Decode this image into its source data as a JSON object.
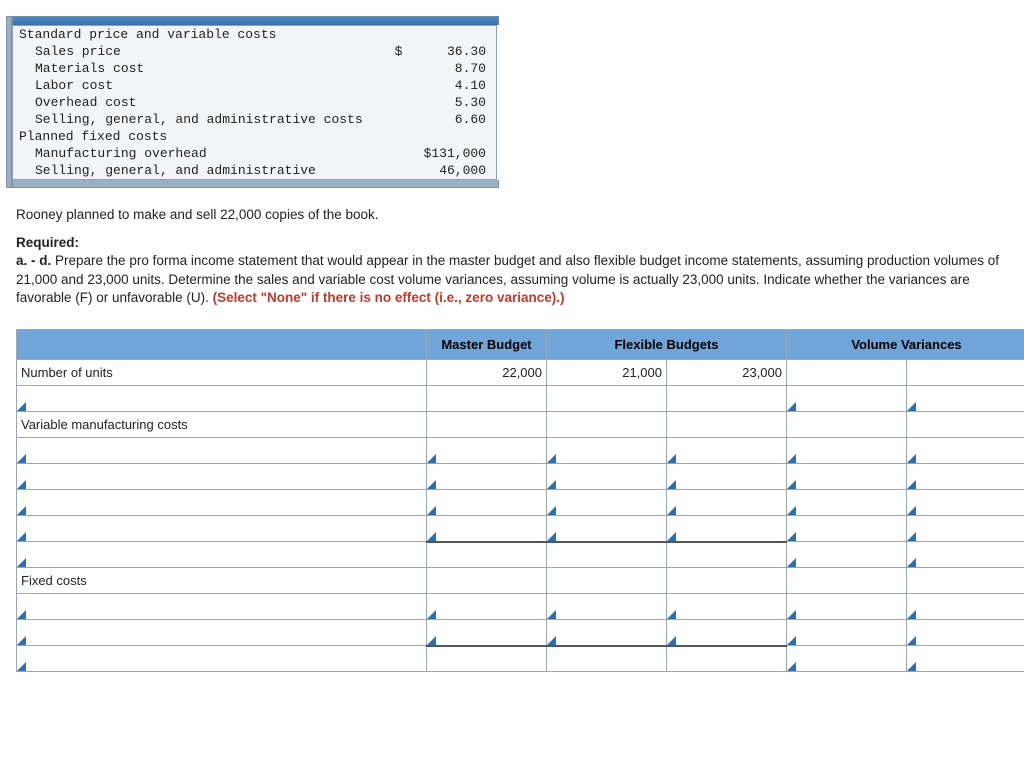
{
  "given": {
    "section1_title": "Standard price and variable costs",
    "rows1": [
      {
        "label": "Sales price",
        "currency": "$",
        "value": "36.30"
      },
      {
        "label": "Materials cost",
        "currency": "",
        "value": "8.70"
      },
      {
        "label": "Labor cost",
        "currency": "",
        "value": "4.10"
      },
      {
        "label": "Overhead cost",
        "currency": "",
        "value": "5.30"
      },
      {
        "label": "Selling, general, and administrative costs",
        "currency": "",
        "value": "6.60"
      }
    ],
    "section2_title": "Planned fixed costs",
    "rows2": [
      {
        "label": "Manufacturing overhead",
        "currency": "",
        "value": "$131,000"
      },
      {
        "label": "Selling, general, and administrative",
        "currency": "",
        "value": "46,000"
      }
    ]
  },
  "narrative": {
    "intro": "Rooney planned to make and sell 22,000 copies of the book.",
    "required_label": "Required:",
    "req_prefix": "a. - d.",
    "req_body": " Prepare the pro forma income statement that would appear in the master budget and also flexible budget income statements, assuming production volumes of 21,000 and 23,000 units. Determine the sales and variable cost volume variances, assuming volume is actually 23,000 units. Indicate whether the variances are favorable (F) or unfavorable (U). ",
    "req_red": "(Select \"None\" if there is no effect (i.e., zero variance).)"
  },
  "answer": {
    "headers": {
      "blank": "",
      "master": "Master Budget",
      "flex": "Flexible Budgets",
      "vol": "Volume Variances"
    },
    "rows": {
      "units_label": "Number of units",
      "units_master": "22,000",
      "units_flex1": "21,000",
      "units_flex2": "23,000",
      "vmc_label": "Variable manufacturing costs",
      "fc_label": "Fixed costs"
    }
  }
}
